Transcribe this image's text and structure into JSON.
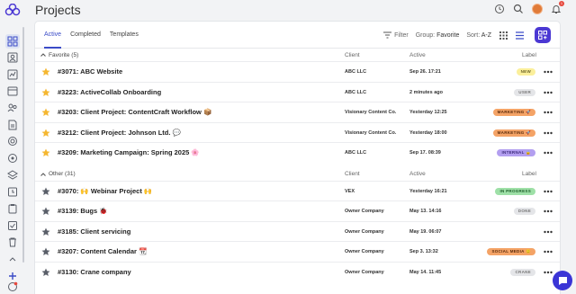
{
  "page": {
    "title": "Projects"
  },
  "toolbar": {
    "tabs": [
      "Active",
      "Completed",
      "Templates"
    ],
    "filter_label": "Filter",
    "group_label": "Group:",
    "group_value": "Favorite",
    "sort_label": "Sort:",
    "sort_value": "A-Z"
  },
  "header_icons": {
    "notification_count": "1"
  },
  "columns": {
    "client": "Client",
    "active": "Active",
    "label": "Label"
  },
  "groups": [
    {
      "title": "Favorite (5)",
      "rows": [
        {
          "name": "#3071: ABC Website",
          "client": "ABC LLC",
          "active": "Sep 26. 17:21",
          "label": "NEW",
          "label_bg": "#fbef9b",
          "label_fg": "#6d6428",
          "starred": true
        },
        {
          "name": "#3223: ActiveCollab Onboarding",
          "client": "ABC LLC",
          "active": "2 minutes ago",
          "label": "USER",
          "label_bg": "#e4e5e8",
          "label_fg": "#777",
          "starred": true
        },
        {
          "name": "#3203: Client Project: ContentCraft Workflow 📦",
          "client": "Visionary Content Co.",
          "active": "Yesterday 12:25",
          "label": "MARKETING 🚀",
          "label_bg": "#f4a366",
          "label_fg": "#5b2b0b",
          "starred": true
        },
        {
          "name": "#3212: Client Project: Johnson Ltd. 💬",
          "client": "Visionary Content Co.",
          "active": "Yesterday 18:00",
          "label": "MARKETING 🚀",
          "label_bg": "#f4a366",
          "label_fg": "#5b2b0b",
          "starred": true
        },
        {
          "name": "#3209: Marketing Campaign: Spring 2025 🌸",
          "client": "ABC LLC",
          "active": "Sep 17. 08:39",
          "label": "INTERNAL 🔒",
          "label_bg": "#b39ff0",
          "label_fg": "#3b2a7a",
          "starred": true
        }
      ]
    },
    {
      "title": "Other (31)",
      "rows": [
        {
          "name": "#3070: 🙌 Webinar Project 🙌",
          "client": "VEX",
          "active": "Yesterday 16:21",
          "label": "IN PROGRESS",
          "label_bg": "#9ee0a7",
          "label_fg": "#1f5e2b",
          "starred": false
        },
        {
          "name": "#3139: Bugs 🐞",
          "client": "Owner Company",
          "active": "May 13. 14:16",
          "label": "DONE",
          "label_bg": "#e4e5e8",
          "label_fg": "#777",
          "starred": false
        },
        {
          "name": "#3185: Client servicing",
          "client": "Owner Company",
          "active": "May 19. 06:07",
          "label": "",
          "label_bg": "",
          "label_fg": "",
          "starred": false
        },
        {
          "name": "#3207: Content Calendar 📆",
          "client": "Owner Company",
          "active": "Sep 3. 13:32",
          "label": "SOCIAL MEDIA 😊",
          "label_bg": "#f4a366",
          "label_fg": "#5b2b0b",
          "starred": false
        },
        {
          "name": "#3130: Crane company",
          "client": "Owner Company",
          "active": "May 14. 11:45",
          "label": "CRANE",
          "label_bg": "#e4e5e8",
          "label_fg": "#777",
          "starred": false
        }
      ]
    }
  ],
  "colors": {
    "accent": "#3a4bc7",
    "add_button": "#4b38d3",
    "star_favorite": "#f5b731",
    "star_other": "#5a5f69"
  },
  "icons": [
    "logo-icon",
    "grid-icon",
    "contact-icon",
    "chart-icon",
    "calendar-icon",
    "people-icon",
    "document-icon",
    "coin-icon",
    "target-icon",
    "layers-icon",
    "clock-icon",
    "clipboard-icon",
    "checklist-icon",
    "trash-icon",
    "chevron-up-icon",
    "plus-icon",
    "help-icon",
    "history-icon",
    "search-icon",
    "bell-icon",
    "filter-icon",
    "grid-view-icon",
    "list-view-icon",
    "add-icon",
    "star-icon",
    "more-icon",
    "chat-icon"
  ]
}
